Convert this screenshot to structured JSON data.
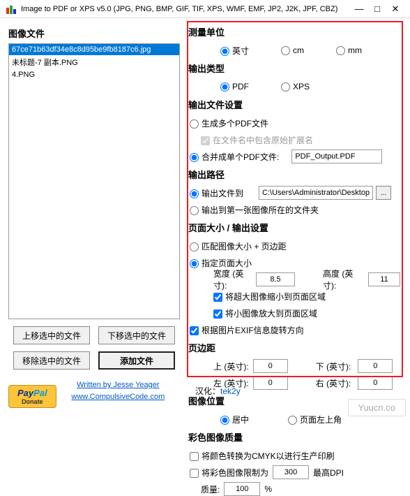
{
  "window": {
    "title": "Image to PDF or XPS  v5.0   (JPG, PNG, BMP, GIF, TIF, XPS, WMF, EMF, JP2, J2K, JPF, CBZ)",
    "minimize": "—",
    "maximize": "□",
    "close": "✕"
  },
  "left": {
    "files_header": "图像文件",
    "files": [
      "67ce71b63df34e8c8d95be9fb8187c6.jpg",
      "未标题-7 副本.PNG",
      "4.PNG"
    ],
    "btn_moveup": "上移选中的文件",
    "btn_movedown": "下移选中的文件",
    "btn_remove": "移除选中的文件",
    "btn_add": "添加文件",
    "credits_written": "Written by Jesse Yeager",
    "credits_url": "www.CompulsiveCode.com",
    "paypal_donate": "Donate"
  },
  "right": {
    "unit_header": "测量单位",
    "unit_inch": "英寸",
    "unit_cm": "cm",
    "unit_mm": "mm",
    "output_type_header": "输出类型",
    "output_pdf": "PDF",
    "output_xps": "XPS",
    "output_file_header": "输出文件设置",
    "gen_multi": "生成多个PDF文件",
    "include_ext": "在文件名中包含原始扩展名",
    "merge_single": "合并成单个PDF文件:",
    "merge_filename": "PDF_Output.PDF",
    "output_path_header": "输出路径",
    "output_to": "输出文件到",
    "output_path_value": "C:\\Users\\Administrator\\Desktop",
    "output_first": "输出到第一张图像所在的文件夹",
    "browse": "...",
    "page_size_header": "页面大小 / 输出设置",
    "match_image": "匹配图像大小 + 页边距",
    "specify_page": "指定页面大小",
    "width_label": "宽度 (英寸):",
    "width_value": "8.5",
    "height_label": "高度 (英寸):",
    "height_value": "11",
    "shrink_large": "将超大图像缩小到页面区域",
    "enlarge_small": "将小图像放大到页面区域",
    "use_exif": "根据图片EXIF信息旋转方向",
    "margin_header": "页边距",
    "margin_top": "上 (英寸):",
    "margin_top_v": "0",
    "margin_bottom": "下 (英寸):",
    "margin_bottom_v": "0",
    "margin_left": "左 (英寸):",
    "margin_left_v": "0",
    "margin_right": "右 (英寸):",
    "margin_right_v": "0",
    "image_pos_header": "图像位置",
    "pos_center": "居中",
    "pos_topleft": "页面左上角",
    "color_quality_header": "彩色图像质量",
    "cmyk": "将颜色转换为CMYK以进行生产印刷",
    "limit_dpi": "将彩色图像限制为",
    "dpi_value": "300",
    "max_dpi": "最高DPI",
    "quality_label": "质量:",
    "quality_value": "100",
    "percent": "%",
    "hanhua_label": "汉化：",
    "hanhua_by": "tek2y"
  },
  "watermark": "Yuucn.co"
}
